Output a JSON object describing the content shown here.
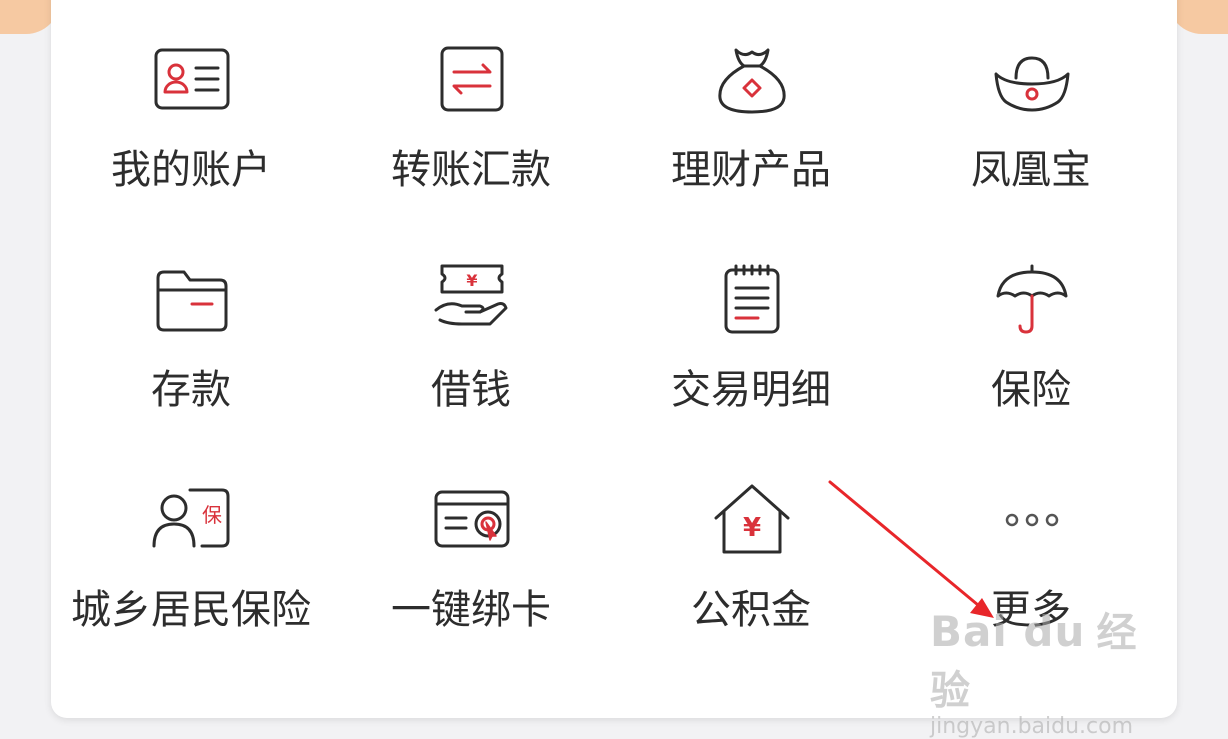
{
  "menu": {
    "items": [
      {
        "label": "我的账户",
        "icon": "account-card-icon"
      },
      {
        "label": "转账汇款",
        "icon": "transfer-icon"
      },
      {
        "label": "理财产品",
        "icon": "money-bag-icon"
      },
      {
        "label": "凤凰宝",
        "icon": "gold-ingot-icon"
      },
      {
        "label": "存款",
        "icon": "folder-icon"
      },
      {
        "label": "借钱",
        "icon": "loan-hand-icon"
      },
      {
        "label": "交易明细",
        "icon": "notepad-icon"
      },
      {
        "label": "保险",
        "icon": "umbrella-icon"
      },
      {
        "label": "城乡居民保险",
        "icon": "person-insurance-icon"
      },
      {
        "label": "一键绑卡",
        "icon": "bind-card-icon"
      },
      {
        "label": "公积金",
        "icon": "house-yuan-icon"
      },
      {
        "label": "更多",
        "icon": "more-dots-icon"
      }
    ]
  },
  "icon_text": {
    "yuan": "¥",
    "bao": "保"
  },
  "colors": {
    "stroke": "#2d2d2d",
    "accent_red": "#d9323b",
    "annotation_arrow": "#e8262a",
    "corner_peach": "#f6c9a2"
  },
  "watermark": {
    "logo": "Bai du",
    "text": "经验",
    "url": "jingyan.baidu.com"
  }
}
